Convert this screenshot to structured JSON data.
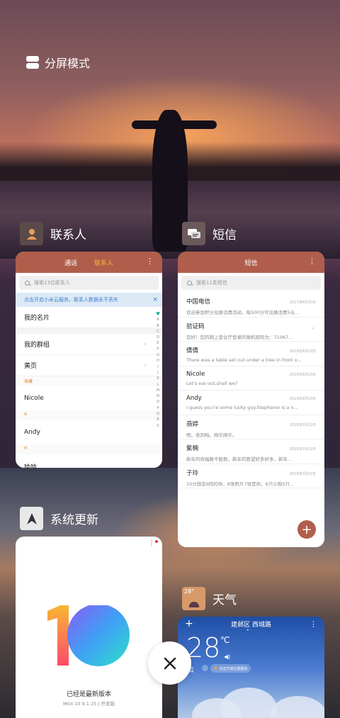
{
  "split_mode": {
    "label": "分屏模式"
  },
  "contacts": {
    "header_label": "联系人",
    "tab_calls": "通话",
    "tab_contacts": "联系人",
    "search_placeholder": "搜索13位联系人",
    "notice_text": "点击开启小米云服务，联系人数据永不丢失",
    "notice_close": "×",
    "rows": [
      {
        "label": "我的名片"
      },
      {
        "label": "我的群组"
      },
      {
        "label": "黄页"
      }
    ],
    "section_star": "收藏",
    "entries": [
      {
        "name": "Nicole"
      },
      {
        "section": "A",
        "name": "Andy"
      },
      {
        "section": "H",
        "name": "哈哈"
      }
    ],
    "alphabet": [
      "♥",
      "A",
      "B",
      "C",
      "D",
      "E",
      "F",
      "G",
      "H",
      "I",
      "J",
      "K",
      "L",
      "M",
      "N",
      "O",
      "P",
      "Q",
      "R",
      "S"
    ]
  },
  "sms": {
    "header_label": "短信",
    "title": "短信",
    "search_placeholder": "搜索11条短信",
    "messages": [
      {
        "name": "中国电信",
        "date": "2017年6月30日",
        "preview": "欢迎参加积分兑换话费活动，每500分可兑换话费5元..."
      },
      {
        "name": "验证码",
        "date": "",
        "preview": "您好！您的网上营业厅登录的随机密码为：71067..."
      },
      {
        "name": "倩倩",
        "date": "2019年6月13日",
        "preview": "There was a table set out under a tree in front o..."
      },
      {
        "name": "Nicole",
        "date": "2019年6月13日",
        "preview": "Let's eat out,shall we?"
      },
      {
        "name": "Andy",
        "date": "2019年6月13日",
        "preview": "I guess you're some lucky guy.Stephanie is a n..."
      },
      {
        "name": "燕婷",
        "date": "2019年2月22日",
        "preview": "嗯。收到啦。网乐网乐。"
      },
      {
        "name": "紫楠",
        "date": "2019年2月22日",
        "preview": "新年的祝福数不胜数，新年的愿望好多好多，新年..."
      },
      {
        "name": "子玲",
        "date": "2019年2月22日",
        "preview": "10分想念9回的你，8张照片7张是你，6只小狗5只..."
      }
    ],
    "fab_label": "+"
  },
  "update": {
    "header_label": "系统更新",
    "title": "已经是最新版本",
    "version": "MIUI 10 9.1.25 | 开发版"
  },
  "weather": {
    "header_label": "天气",
    "icon_temp": "28°",
    "location": "建邺区 西城路",
    "temp": "28",
    "unit": "℃",
    "condition": "云",
    "tip": "点击开启位置服务",
    "plus": "+",
    "more": "⋮"
  },
  "colors": {
    "accent": "#b05e4b",
    "tab_active": "#ffb23a",
    "notice_blue": "#3b7fd0"
  }
}
